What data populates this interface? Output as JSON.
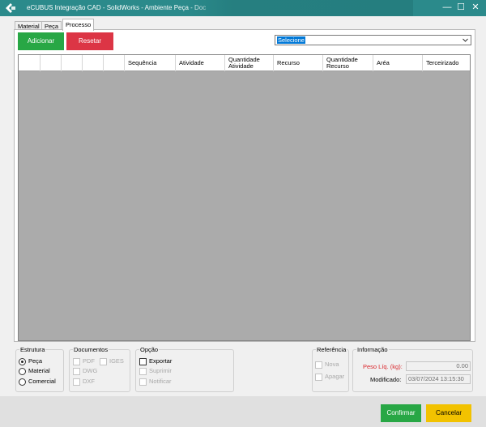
{
  "window": {
    "title": "eCUBUS Integração CAD - SolidWorks - Ambiente Peça - Doc",
    "minimize_glyph": "—",
    "maximize_glyph": "☐",
    "close_glyph": "✕",
    "logo_icon": "ecubus-logo-icon",
    "accent_color": "#2b8a8b"
  },
  "tabs": [
    {
      "label": "Material"
    },
    {
      "label": "Peça"
    },
    {
      "label": "Processo"
    }
  ],
  "toolbar": {
    "add_label": "Adicionar",
    "reset_label": "Resetar",
    "select_value": "Selecione",
    "add_color": "#28a745",
    "reset_color": "#dc3545"
  },
  "grid": {
    "columns": [
      "",
      "",
      "",
      "",
      "",
      "Sequência",
      "Atividade",
      "Quantidade Atividade",
      "Recurso",
      "Quantidade Recurso",
      "Aréa",
      "Terceirizado"
    ]
  },
  "estrutura": {
    "title": "Estrutura",
    "options": [
      {
        "label": "Peça",
        "checked": true
      },
      {
        "label": "Material",
        "checked": false
      },
      {
        "label": "Comercial",
        "checked": false
      }
    ]
  },
  "documentos": {
    "title": "Documentos",
    "pdf": "PDF",
    "iges": "IGES",
    "dwg": "DWG",
    "dxf": "DXF"
  },
  "opcao": {
    "title": "Opção",
    "exportar": "Exportar",
    "suprimir": "Suprimir",
    "notificar": "Notificar"
  },
  "referencia": {
    "title": "Referência",
    "nova": "Nova",
    "apagar": "Apagar"
  },
  "informacao": {
    "title": "Informação",
    "peso_label": "Peso Líq. (kg):",
    "peso_value": "0.00",
    "modificado_label": "Modificado:",
    "modificado_value": "03/07/2024 13:15:30",
    "peso_label_color": "#d9262b"
  },
  "footer": {
    "confirm_label": "Confirmar",
    "cancel_label": "Cancelar",
    "confirm_color": "#28a745",
    "cancel_color": "#f2c200"
  }
}
